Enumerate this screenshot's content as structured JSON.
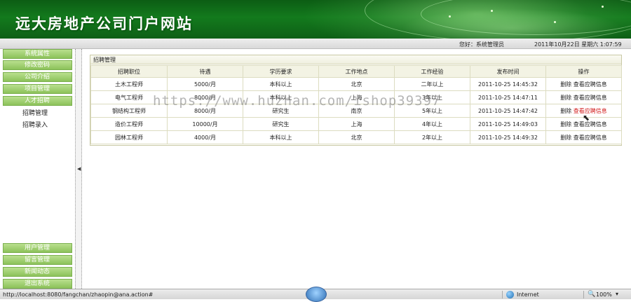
{
  "header": {
    "site_title": "远大房地产公司门户网站"
  },
  "infobar": {
    "greeting": "您好：系统管理员",
    "datetime": "2011年10月22日 星期六 1:07:59"
  },
  "sidebar": {
    "top_menu": [
      {
        "label": "系统属性"
      },
      {
        "label": "修改密码"
      },
      {
        "label": "公司介绍"
      },
      {
        "label": "项目管理"
      },
      {
        "label": "人才招聘"
      }
    ],
    "sub_menu": [
      {
        "label": "招聘管理"
      },
      {
        "label": "招聘录入"
      }
    ],
    "bottom_menu": [
      {
        "label": "用户管理"
      },
      {
        "label": "留言管理"
      },
      {
        "label": "新闻动态"
      },
      {
        "label": "退出系统"
      }
    ]
  },
  "panel": {
    "title": "招聘管理",
    "columns": [
      "招聘职位",
      "待遇",
      "学历要求",
      "工作地点",
      "工作经验",
      "发布时间",
      "操作"
    ],
    "rows": [
      {
        "position": "土木工程师",
        "salary": "5000/月",
        "education": "本科以上",
        "location": "北京",
        "experience": "二年以上",
        "published": "2011-10-25 14:45:32",
        "delete": "删除",
        "view": "查看应聘信息"
      },
      {
        "position": "电气工程师",
        "salary": "8000/月",
        "education": "本科以上",
        "location": "上海",
        "experience": "3年以上",
        "published": "2011-10-25 14:47:11",
        "delete": "删除",
        "view": "查看应聘信息"
      },
      {
        "position": "钢结构工程师",
        "salary": "8000/月",
        "education": "研究生",
        "location": "南京",
        "experience": "5年以上",
        "published": "2011-10-25 14:47:42",
        "delete": "删除",
        "view": "查看应聘信息"
      },
      {
        "position": "造价工程师",
        "salary": "10000/月",
        "education": "研究生",
        "location": "上海",
        "experience": "4年以上",
        "published": "2011-10-25 14:49:03",
        "delete": "删除",
        "view": "查看应聘信息"
      },
      {
        "position": "园林工程师",
        "salary": "4000/月",
        "education": "本科以上",
        "location": "北京",
        "experience": "2年以上",
        "published": "2011-10-25 14:49:32",
        "delete": "删除",
        "view": "查看应聘信息"
      }
    ]
  },
  "watermark": "https://www.huzhan.com/ishop39397",
  "statusbar": {
    "url": "http://localhost:8080/fangchan/zhaopin@ana.action#",
    "zone": "Internet",
    "zoom": "100%"
  },
  "colors": {
    "banner_green": "#137a1d",
    "menu_green": "#8cc25a",
    "hover_link_red": "#d11b1b"
  }
}
